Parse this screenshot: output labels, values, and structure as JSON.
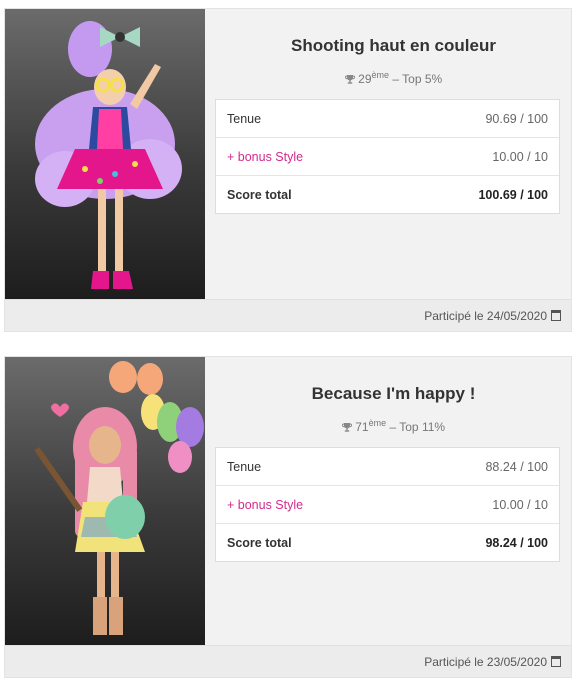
{
  "entries": [
    {
      "title": "Shooting haut en couleur",
      "rank_num": "29",
      "rank_suffix": "ème",
      "rank_top": "– Top 5%",
      "outfit_label": "Tenue",
      "outfit_score": "90.69 / 100",
      "bonus_label": "+ bonus Style",
      "bonus_score": "10.00 / 10",
      "total_label": "Score total",
      "total_score": "100.69 / 100",
      "participated": "Participé le 24/05/2020"
    },
    {
      "title": "Because I'm happy !",
      "rank_num": "71",
      "rank_suffix": "ème",
      "rank_top": "– Top 11%",
      "outfit_label": "Tenue",
      "outfit_score": "88.24 / 100",
      "bonus_label": "+ bonus Style",
      "bonus_score": "10.00 / 10",
      "total_label": "Score total",
      "total_score": "98.24 / 100",
      "participated": "Participé le 23/05/2020"
    }
  ],
  "icons": {
    "rank": "trophy-icon",
    "date": "calendar-icon"
  },
  "colors": {
    "bonus": "#d42a8c",
    "card_bg": "#f2f2f2"
  }
}
